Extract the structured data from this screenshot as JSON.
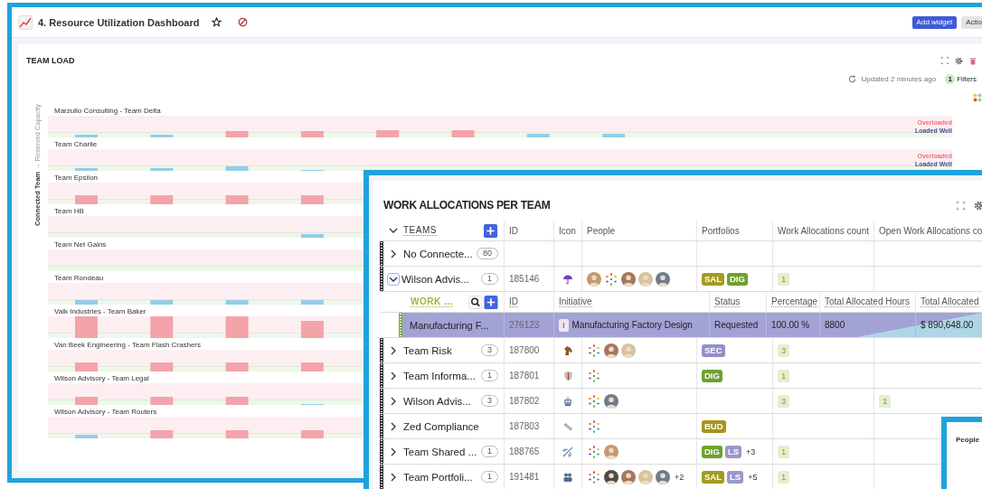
{
  "dashboard": {
    "title": "4. Resource Utilization Dashboard",
    "buttons": [
      {
        "label": "Add widget",
        "kind": "primary"
      },
      {
        "label": "Actio",
        "kind": "secondary"
      }
    ]
  },
  "team_load": {
    "title": "TEAM LOAD",
    "updated": "Updated 2 minutes ago",
    "filter_count": "1",
    "filters_label": "Filters",
    "axis_label": "**Connected Team** → Reserved Capacity",
    "rows": [
      {
        "name": "Marzullo Consulting - Team Delta",
        "overloaded_label": "Overloaded",
        "loaded_well_label": "Loaded Well"
      },
      {
        "name": "Team Charlie",
        "overloaded_label": "Overloaded",
        "loaded_well_label": "Loaded Well"
      },
      {
        "name": "Team Epsilon"
      },
      {
        "name": "Team HB"
      },
      {
        "name": "Team Net Gains"
      },
      {
        "name": "Team Rondeau"
      },
      {
        "name": "Valk Industries - Team Baker"
      },
      {
        "name": "Van Beek Engineering - Team Flash Crashers"
      },
      {
        "name": "Wilson Advisory - Team Legal"
      },
      {
        "name": "Wilson Advisory - Team Routers"
      }
    ]
  },
  "work_allocations": {
    "title": "WORK ALLOCATIONS PER TEAM",
    "columns": [
      "TEAMS",
      "ID",
      "Icon",
      "People",
      "Portfolios",
      "Work Allocations count",
      "Open Work Allocations co"
    ],
    "teams": [
      {
        "name": "No Connecte...",
        "count": "80",
        "expanded": false
      },
      {
        "name": "Wilson Advis...",
        "count": "1",
        "expanded": true,
        "id": "185146",
        "people": [
          {
            "kind": "photo"
          },
          {
            "kind": "logo"
          },
          {
            "kind": "photo"
          },
          {
            "kind": "photo"
          },
          {
            "kind": "photo"
          }
        ],
        "portfolios": [
          {
            "label": "SAL",
            "color": "#a39c1e"
          },
          {
            "label": "DIG",
            "color": "#6ea12f"
          }
        ],
        "wa_count": "1",
        "work_allocations": {
          "columns": [
            "WORK ...",
            "ID",
            "Initiative",
            "Status",
            "Percentage",
            "Total Allocated Hours",
            "Total Allocated"
          ],
          "rows": [
            {
              "name": "Manufacturing F...",
              "id": "276123",
              "type": "I",
              "initiative": "Manufacturing Factory Design",
              "status": "Requested",
              "percentage": "100.00 %",
              "hours": "8800",
              "total": "$ 890,648.00"
            }
          ]
        }
      },
      {
        "name": "Team Risk",
        "count": "3",
        "expanded": false,
        "id": "187800",
        "people": [
          {
            "kind": "logo"
          },
          {
            "kind": "photo"
          },
          {
            "kind": "photo"
          }
        ],
        "portfolios": [
          {
            "label": "SEC",
            "color": "#9290c8"
          }
        ],
        "wa_count": "3"
      },
      {
        "name": "Team Informa...",
        "count": "1",
        "expanded": false,
        "id": "187801",
        "people": [
          {
            "kind": "logo"
          }
        ],
        "portfolios": [
          {
            "label": "DIG",
            "color": "#6ea12f"
          }
        ],
        "wa_count": "1"
      },
      {
        "name": "Wilson Advis...",
        "count": "3",
        "expanded": false,
        "id": "187802",
        "people": [
          {
            "kind": "logo"
          },
          {
            "kind": "photo"
          }
        ],
        "wa_count": "3",
        "open_wa_count": "1"
      },
      {
        "name": "Zed Compliance",
        "expanded": false,
        "id": "187803",
        "people": [
          {
            "kind": "logo"
          }
        ],
        "portfolios": [
          {
            "label": "BUD",
            "color": "#a4961b"
          }
        ]
      },
      {
        "name": "Team Shared ...",
        "count": "1",
        "expanded": false,
        "id": "188765",
        "people": [
          {
            "kind": "logo"
          },
          {
            "kind": "photo"
          }
        ],
        "portfolios": [
          {
            "label": "DIG",
            "color": "#6ea12f"
          },
          {
            "label": "LS",
            "color": "#9a98c9"
          }
        ],
        "portfolio_more": "+3",
        "wa_count": "1"
      },
      {
        "name": "Team Portfoli...",
        "count": "1",
        "expanded": false,
        "id": "191481",
        "people": [
          {
            "kind": "logo"
          },
          {
            "kind": "photo"
          },
          {
            "kind": "photo"
          },
          {
            "kind": "photo"
          },
          {
            "kind": "photo"
          }
        ],
        "people_more": "+2",
        "portfolios": [
          {
            "label": "SAL",
            "color": "#a39c1e"
          },
          {
            "label": "LS",
            "color": "#9a98c9"
          }
        ],
        "portfolio_more": "+5",
        "wa_count": "1"
      }
    ]
  },
  "people_panel": {
    "title": "People"
  }
}
